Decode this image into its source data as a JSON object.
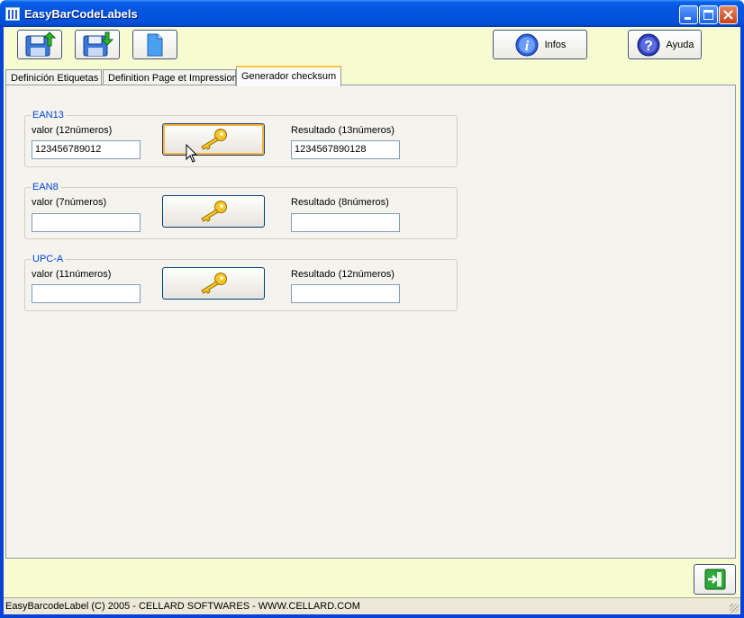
{
  "window": {
    "title": "EasyBarCodeLabels"
  },
  "toolbar": {
    "infos_label": "Infos",
    "help_label": "Ayuda"
  },
  "tabs": [
    {
      "label": "Definición Etiquetas"
    },
    {
      "label": "Definition Page et Impression"
    },
    {
      "label": "Generador checksum"
    }
  ],
  "groups": [
    {
      "title": "EAN13",
      "input_label": "valor (12números)",
      "input_value": "123456789012",
      "result_label": "Resultado (13números)",
      "result_value": "1234567890128"
    },
    {
      "title": "EAN8",
      "input_label": "valor (7números)",
      "input_value": "",
      "result_label": "Resultado (8números)",
      "result_value": ""
    },
    {
      "title": "UPC-A",
      "input_label": "valor (11números)",
      "input_value": "",
      "result_label": "Resultado (12números)",
      "result_value": ""
    }
  ],
  "status": {
    "text": "EasyBarcodeLabel (C) 2005 - CELLARD SOFTWARES - WWW.CELLARD.COM"
  },
  "colors": {
    "titlebar": "#0355e0",
    "client_bg": "#f7fcd0",
    "group_title": "#0046d5",
    "key_gold": "#f0c020"
  },
  "icons": {
    "open": "floppy-up-icon",
    "save": "floppy-down-icon",
    "new": "new-document-icon",
    "info": "info-icon",
    "help": "help-icon",
    "key": "key-icon",
    "exit": "exit-icon"
  }
}
